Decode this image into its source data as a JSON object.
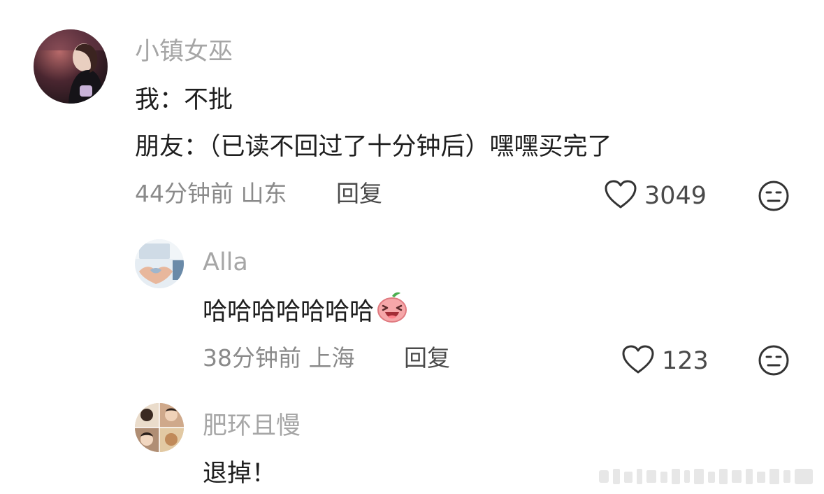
{
  "comments": [
    {
      "username": "小镇女巫",
      "lines": [
        "我：不批",
        "朋友：（已读不回过了十分钟后）嘿嘿买完了"
      ],
      "time": "44分钟前",
      "location": "山东",
      "reply_label": "回复",
      "likes": "3049",
      "like_icon": "heart-outline-icon",
      "dislike_icon": "meh-face-icon"
    },
    {
      "username": "Alla",
      "text": "哈哈哈哈哈哈哈",
      "emoji": "laughing-peach-emoji",
      "time": "38分钟前",
      "location": "上海",
      "reply_label": "回复",
      "likes": "123",
      "like_icon": "heart-outline-icon",
      "dislike_icon": "meh-face-icon"
    },
    {
      "username": "肥环且慢",
      "text": "退掉！"
    }
  ],
  "colors": {
    "username": "#a6a6a6",
    "text": "#1e1e1e",
    "meta": "#8a8a8a",
    "icon": "#333333"
  }
}
